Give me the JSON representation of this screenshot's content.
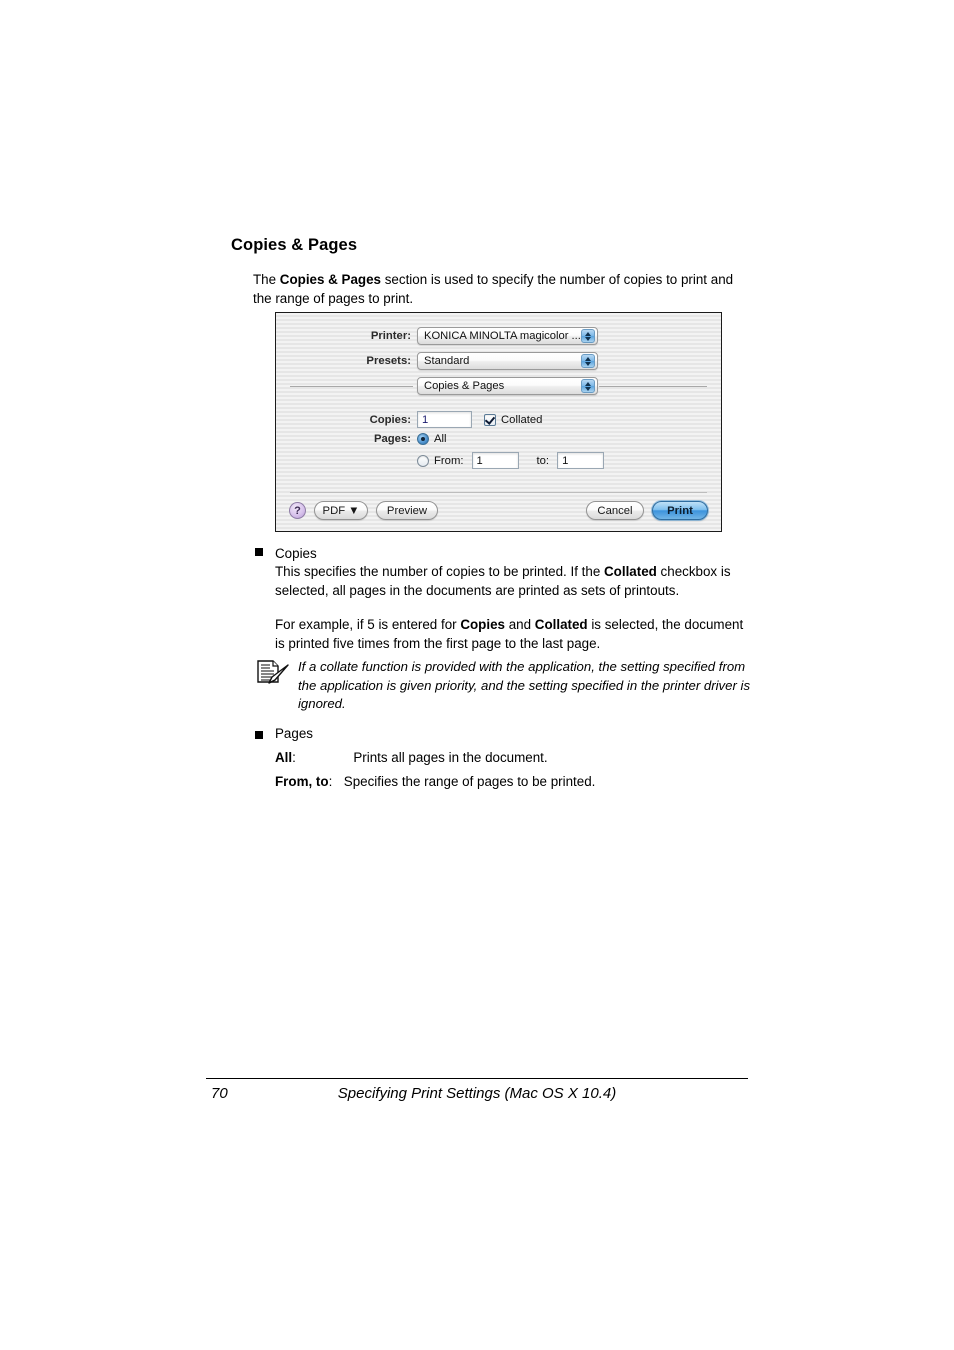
{
  "document": {
    "heading": "Copies & Pages",
    "intro_pre": "The ",
    "intro_bold": "Copies & Pages",
    "intro_post": " section is used to specify the number of copies to print and the range of pages to print."
  },
  "dialog": {
    "printer_label": "Printer:",
    "printer_value": "KONICA MINOLTA magicolor ...",
    "presets_label": "Presets:",
    "presets_value": "Standard",
    "pane_value": "Copies & Pages",
    "copies_label": "Copies:",
    "copies_value": "1",
    "collated_label": "Collated",
    "collated_checked": true,
    "pages_label": "Pages:",
    "pages_all_label": "All",
    "pages_all_selected": true,
    "pages_from_label": "From:",
    "pages_from_value": "1",
    "pages_to_label": "to:",
    "pages_to_value": "1",
    "help_glyph": "?",
    "pdf_button": "PDF ▼",
    "preview_button": "Preview",
    "cancel_button": "Cancel",
    "print_button": "Print",
    "accent_default_button": "#3d93dc",
    "accent_popup_arrows": "#7cb8e8",
    "help_button_color": "#c9aee2"
  },
  "sections": [
    {
      "bullet_label": "Copies",
      "paragraph_1_a": "This specifies the number of copies to be printed. If the ",
      "paragraph_1_b": "Collated",
      "paragraph_1_c": " checkbox is selected, all pages in the documents are printed as sets of printouts.",
      "paragraph_2_a": "For example, if 5 is entered for ",
      "paragraph_2_b": "Copies",
      "paragraph_2_c": " and ",
      "paragraph_2_d": "Collated",
      "paragraph_2_e": " is selected, the document is printed five times from the first page to the last page."
    }
  ],
  "note": {
    "icon_name": "note-pencil-icon",
    "text": "If a collate function is provided with the application, the setting specified from the application is given priority, and the setting specified in the printer driver is ignored."
  },
  "pages_section": {
    "bullet_label": "Pages",
    "definitions": [
      {
        "term": "All",
        "separator": ":",
        "description": "Prints all pages in the document."
      },
      {
        "term": "From, to",
        "separator": ":",
        "description": "Specifies the range of pages to be printed."
      }
    ]
  },
  "footer": {
    "page_number": "70",
    "title": "Specifying Print Settings (Mac OS X 10.4)"
  }
}
